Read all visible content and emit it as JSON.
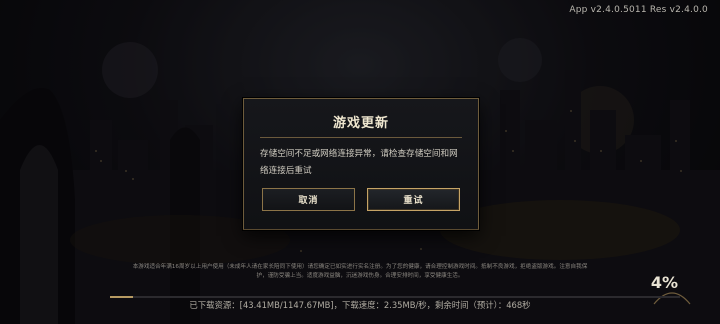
{
  "version_text": "App v2.4.0.5011 Res v2.4.0.0",
  "dialog": {
    "title": "游戏更新",
    "message": "存储空间不足或网络连接异常，请检查存储空间和网络连接后重试",
    "cancel_label": "取消",
    "retry_label": "重试"
  },
  "footer": {
    "notice": "本游戏适合年满16周岁以上用户使用（未成年人请在家长陪同下使用）请您确定已如实进行实名注册。为了您的健康，请合理控制游戏时间。抵制不良游戏，拒绝盗版游戏。注意自我保护，谨防受骗上当。适度游戏益脑，沉迷游戏伤身。合理安排时间，享受健康生活。",
    "download_info": "已下载资源：[43.41MB/1147.67MB]，下载速度：2.35MB/秒，剩余时间（预计）：468秒",
    "percent_text": "4%",
    "progress": 0.04
  },
  "colors": {
    "accent_gold": "#c6a466",
    "dialog_border": "#6e5c3c",
    "text_light": "#eee6cf"
  }
}
